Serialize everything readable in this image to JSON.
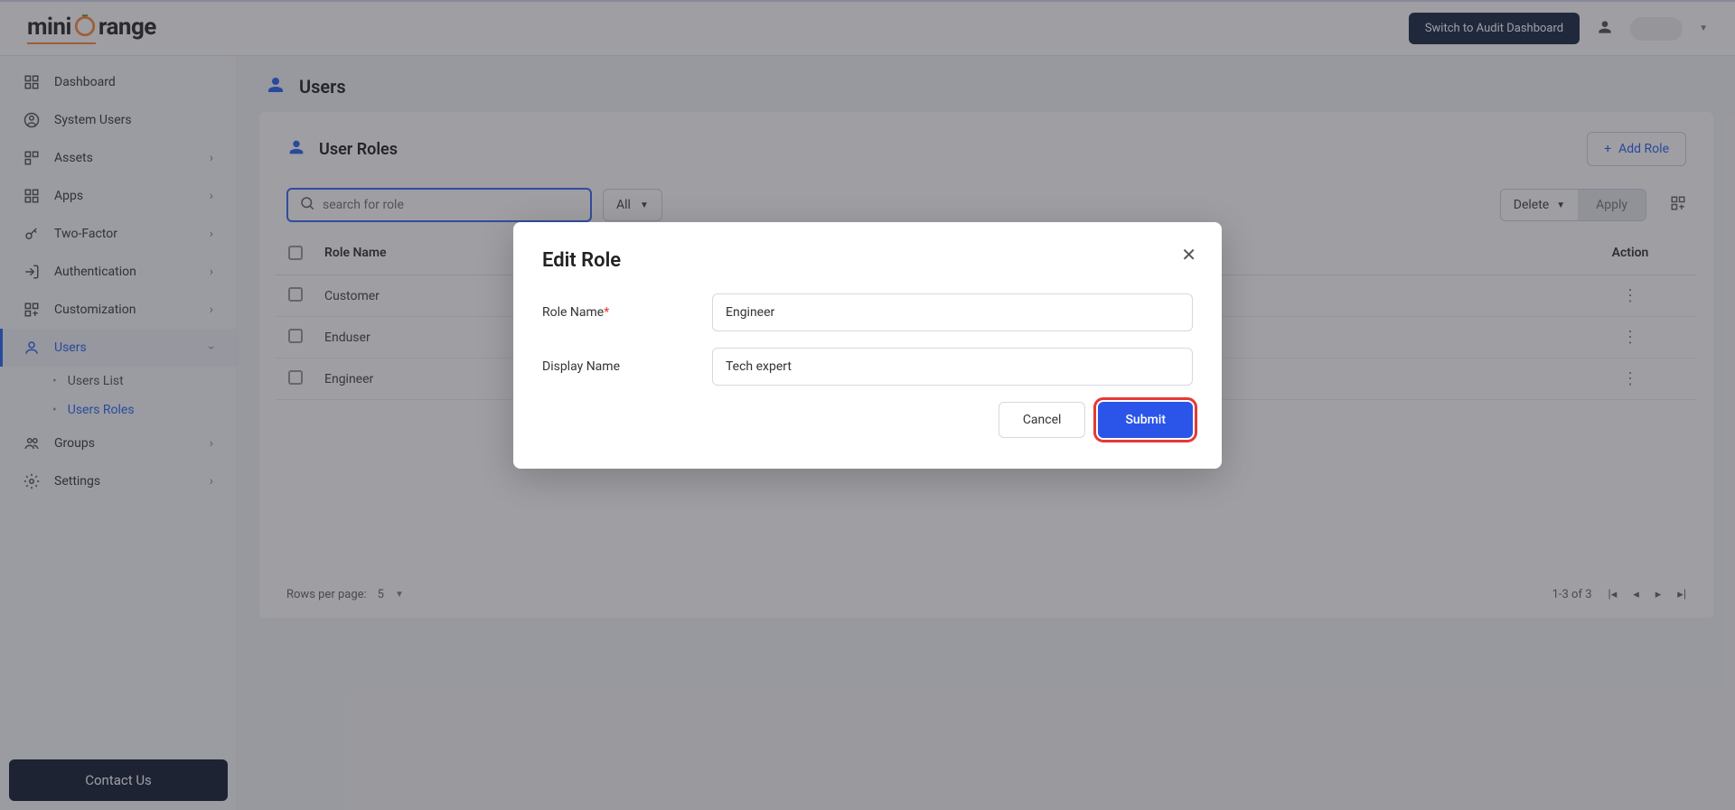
{
  "topbar": {
    "logo_prefix": "mini",
    "logo_suffix": "range",
    "switch_label": "Switch to Audit Dashboard"
  },
  "sidebar": {
    "items": [
      {
        "label": "Dashboard",
        "expandable": false
      },
      {
        "label": "System Users",
        "expandable": false
      },
      {
        "label": "Assets",
        "expandable": true
      },
      {
        "label": "Apps",
        "expandable": true
      },
      {
        "label": "Two-Factor",
        "expandable": true
      },
      {
        "label": "Authentication",
        "expandable": true
      },
      {
        "label": "Customization",
        "expandable": true
      },
      {
        "label": "Users",
        "expandable": true,
        "active": true,
        "expanded": true
      },
      {
        "label": "Groups",
        "expandable": true
      },
      {
        "label": "Settings",
        "expandable": true
      }
    ],
    "users_sub": [
      {
        "label": "Users List"
      },
      {
        "label": "Users Roles",
        "active": true
      }
    ],
    "contact": "Contact Us"
  },
  "page": {
    "title": "Users",
    "panel_title": "User Roles",
    "add_role": "Add Role",
    "search_placeholder": "search for role",
    "all_label": "All",
    "delete_label": "Delete",
    "apply_label": "Apply",
    "col_name": "Role Name",
    "col_action": "Action",
    "rows": [
      {
        "name": "Customer"
      },
      {
        "name": "Enduser"
      },
      {
        "name": "Engineer"
      }
    ],
    "rows_per_page_label": "Rows per page:",
    "rows_per_page_value": "5",
    "range_text": "1-3 of 3"
  },
  "modal": {
    "title": "Edit Role",
    "role_name_label": "Role Name",
    "role_name_value": "Engineer",
    "display_name_label": "Display Name",
    "display_name_value": "Tech expert",
    "cancel": "Cancel",
    "submit": "Submit"
  }
}
